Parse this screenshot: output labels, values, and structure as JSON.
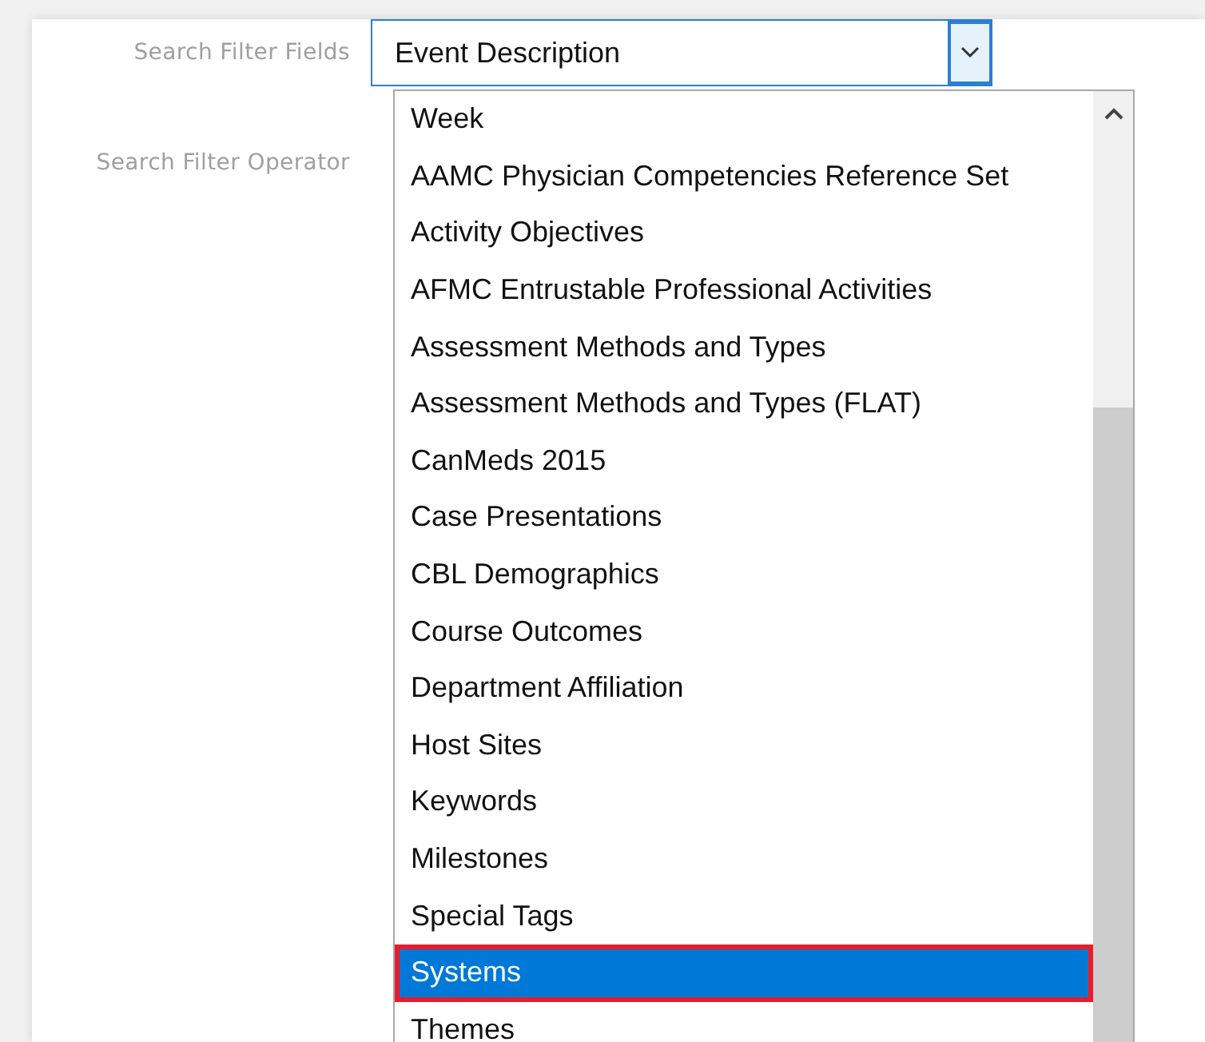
{
  "fields": [
    {
      "label": "Search Filter Fields"
    },
    {
      "label": "Search Filter Operator"
    }
  ],
  "select": {
    "value": "Event Description",
    "expanded": true
  },
  "options": [
    {
      "label": "Week",
      "selected": false
    },
    {
      "label": "AAMC Physician Competencies Reference Set",
      "selected": false
    },
    {
      "label": "Activity Objectives",
      "selected": false
    },
    {
      "label": "AFMC Entrustable Professional Activities",
      "selected": false
    },
    {
      "label": "Assessment Methods and Types",
      "selected": false
    },
    {
      "label": "Assessment Methods and Types (FLAT)",
      "selected": false
    },
    {
      "label": "CanMeds 2015",
      "selected": false
    },
    {
      "label": "Case Presentations",
      "selected": false
    },
    {
      "label": "CBL Demographics",
      "selected": false
    },
    {
      "label": "Course Outcomes",
      "selected": false
    },
    {
      "label": "Department Affiliation",
      "selected": false
    },
    {
      "label": "Host Sites",
      "selected": false
    },
    {
      "label": "Keywords",
      "selected": false
    },
    {
      "label": "Milestones",
      "selected": false
    },
    {
      "label": "Special Tags",
      "selected": false
    },
    {
      "label": "Systems",
      "selected": true
    },
    {
      "label": "Themes",
      "selected": false
    }
  ]
}
